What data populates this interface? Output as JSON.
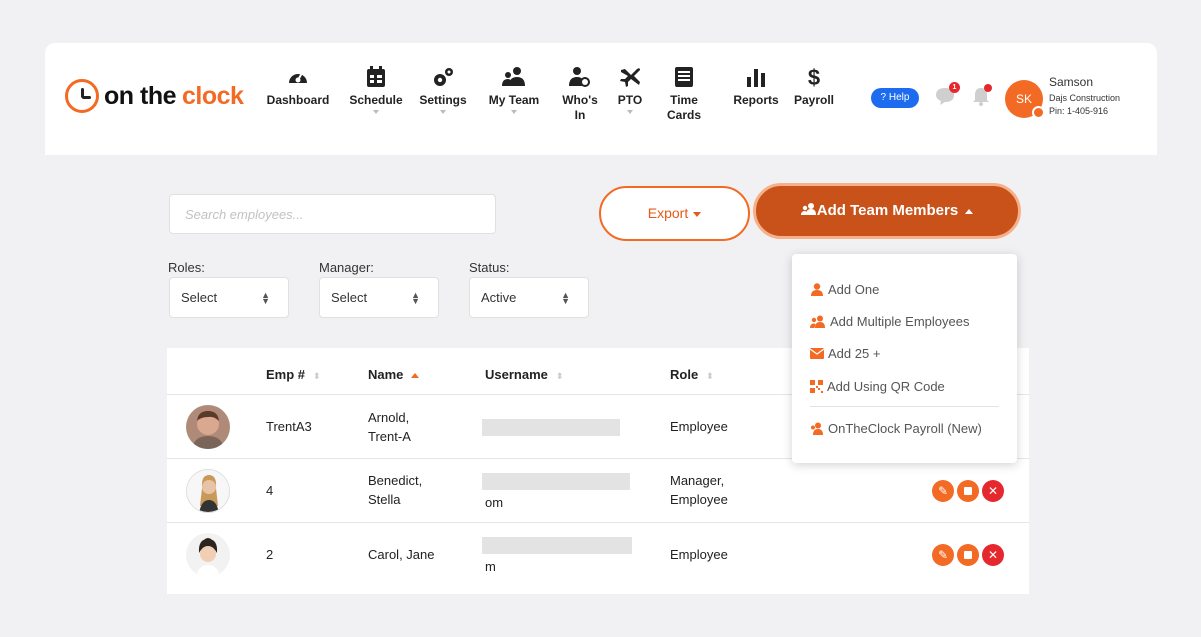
{
  "brand": {
    "word1": "on the",
    "word2": "clock",
    "accent": "#f26a24"
  },
  "nav": [
    {
      "label": "Dashboard",
      "icon": "dashboard-gauge-icon",
      "dropdown": false
    },
    {
      "label": "Schedule",
      "icon": "calendar-icon",
      "dropdown": true
    },
    {
      "label": "Settings",
      "icon": "gears-icon",
      "dropdown": true
    },
    {
      "label": "My Team",
      "icon": "team-icon",
      "dropdown": true
    },
    {
      "label": "Who's In",
      "icon": "user-clock-icon",
      "dropdown": false
    },
    {
      "label": "PTO",
      "icon": "plane-icon",
      "dropdown": true
    },
    {
      "label": "Time Cards",
      "icon": "timecard-icon",
      "dropdown": false
    },
    {
      "label": "Reports",
      "icon": "bar-chart-icon",
      "dropdown": false
    },
    {
      "label": "Payroll",
      "icon": "dollar-icon",
      "dropdown": false
    }
  ],
  "help": {
    "label": "? Help"
  },
  "notifications": {
    "chat_badge": "1"
  },
  "user": {
    "initials": "SK",
    "name": "Samson",
    "company": "Dajs Construction",
    "pin": "Pin: 1-405-916"
  },
  "search": {
    "placeholder": "Search employees..."
  },
  "export": {
    "label": "Export"
  },
  "add_team": {
    "label": "Add Team Members"
  },
  "filters": [
    {
      "label": "Roles:",
      "value": "Select"
    },
    {
      "label": "Manager:",
      "value": "Select"
    },
    {
      "label": "Status:",
      "value": "Active"
    }
  ],
  "table": {
    "columns": [
      "Emp #",
      "Name",
      "Username",
      "Role"
    ],
    "rows": [
      {
        "emp": "TrentA3",
        "name1": "Arnold,",
        "name2": "Trent-A",
        "username": "",
        "role1": "Employee",
        "role2": ""
      },
      {
        "emp": "4",
        "name1": "Benedict,",
        "name2": "Stella",
        "username": "om",
        "role1": "Manager,",
        "role2": "Employee"
      },
      {
        "emp": "2",
        "name1": "Carol, Jane",
        "name2": "",
        "username": "m",
        "role1": "Employee",
        "role2": ""
      }
    ]
  },
  "add_menu": {
    "items": [
      {
        "label": "Add One",
        "icon": "user-icon"
      },
      {
        "label": "Add Multiple Employees",
        "icon": "users-icon"
      },
      {
        "label": "Add 25 +",
        "icon": "envelope-icon"
      },
      {
        "label": "Add Using QR Code",
        "icon": "qr-code-icon"
      },
      {
        "label": "OnTheClock Payroll (New)",
        "icon": "payroll-users-icon"
      }
    ]
  },
  "colors": {
    "orange": "#f26a24",
    "dark_orange": "#c8521a",
    "delete_red": "#e5282d",
    "help_blue": "#1d6cf0"
  }
}
